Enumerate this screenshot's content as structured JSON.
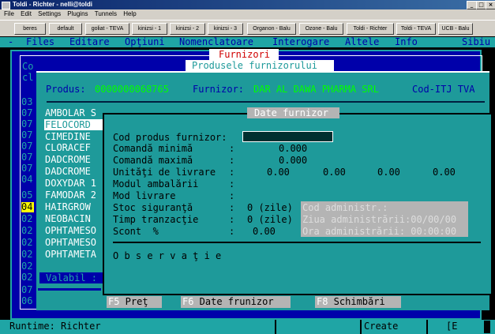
{
  "window": {
    "title": "Toldi - Richter  -  nelli@toldi"
  },
  "menubar": [
    "File",
    "Edit",
    "Settings",
    "Plugins",
    "Tunnels",
    "Help"
  ],
  "toolbar": [
    "beres",
    "default",
    "goliat - TEVA",
    "kinizsi - 1",
    "kinizsi - 2",
    "kinizsi - 3",
    "Organon - Balu",
    "Ozone - Balu",
    "Toldi - Richter",
    "Toldi - TEVA",
    "UCB - Balu"
  ],
  "app_menu": {
    "dash": "-",
    "items": [
      "Files",
      "Editare",
      "Opţiuni",
      "Nomenclatoare",
      "Interogare",
      "Altele",
      "Info"
    ],
    "right": "Sibiu"
  },
  "bg_left": {
    "top_rows": [
      "Co",
      "cl"
    ],
    "codes": [
      "03",
      "07",
      "07",
      "07",
      "07",
      "07",
      "07",
      "04",
      "05",
      "04",
      "02",
      "02",
      "02",
      "02",
      "02",
      "02",
      "07",
      "06"
    ]
  },
  "furnizori_title": "Furnizori",
  "produse_title": "Produsele furnizorului",
  "header": {
    "produs_label": "Produs:",
    "produs_value": "0000000068765",
    "furnizor_label": "Furnizor:",
    "furnizor_value": "DAR AL DAWA PHARMA SRL",
    "right_label": "Cod-ITJ TVA"
  },
  "products": [
    "AMBOLAR S",
    "FELOCORD",
    "CIMEDINE",
    "CLORACEF",
    "DADCROME",
    "DADCROME",
    "DOXYDAR 1",
    "FAMODAR 2",
    "HAIRGROW",
    "NEOBACIN",
    "OPHTAMESO",
    "OPHTAMESO",
    "OPHTAMETA"
  ],
  "valabil_label": "Valabil :",
  "date_furnizor": {
    "title": "Date furnizor",
    "cod_label": "Cod produs furnizor:",
    "rows": [
      {
        "label": "Comandă minimă",
        "colon": ":",
        "value": "0.000"
      },
      {
        "label": "Comandă maximă",
        "colon": ":",
        "value": "0.000"
      },
      {
        "label": "Unităţi de livrare",
        "colon": ":",
        "values": [
          "0.00",
          "0.00",
          "0.00",
          "0.00"
        ]
      },
      {
        "label": "Modul ambalării",
        "colon": ":"
      },
      {
        "label": "Mod livrare",
        "colon": ":"
      },
      {
        "label": "Stoc siguranţă",
        "colon": ":",
        "value": "0 (zile)"
      },
      {
        "label": "Timp tranzacţie",
        "colon": ":",
        "value": "0 (zile)"
      },
      {
        "label": "Scont  %",
        "colon": ":",
        "value": "0.00"
      }
    ],
    "admin": [
      "Cod administr.:",
      "Ziua administrării:00/00/00",
      "Ora administrării: 00:00:00"
    ],
    "observatie": "O b s e r v a ţ i e"
  },
  "fkeys": [
    {
      "key": "F5",
      "label": " Preţ"
    },
    {
      "key": "F6",
      "label": " Date frunizor"
    },
    {
      "key": "F8",
      "label": " Schimbări"
    }
  ],
  "status": {
    "runtime": "Runtime: Richter",
    "mode": "Create",
    "flag": "[E"
  }
}
